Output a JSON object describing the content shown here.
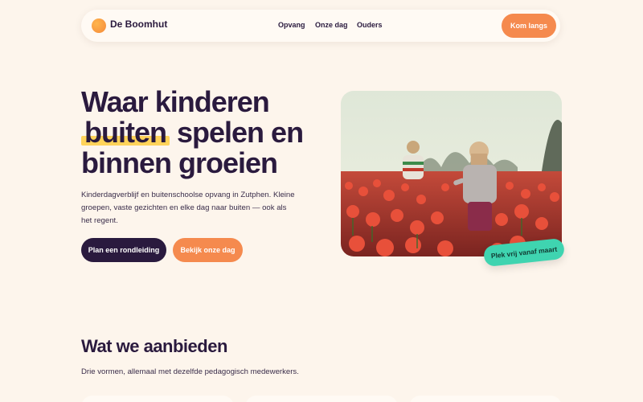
{
  "nav": {
    "brand": "De Boomhut",
    "links": [
      "Opvang",
      "Onze dag",
      "Ouders"
    ],
    "cta": "Kom langs"
  },
  "hero": {
    "title_part1": "Waar kinderen",
    "title_highlight": "buiten",
    "title_part2": "spelen en binnen groeien",
    "subtitle": "Kinderdagverblijf en buitenschoolse opvang in Zutphen. Kleine groepen, vaste gezichten en elke dag naar buiten — ook als het regent.",
    "primary_button": "Plan een rondleiding",
    "secondary_button": "Bekijk onze dag",
    "badge": "Plek vrij vanaf maart"
  },
  "offer": {
    "title": "Wat we aanbieden",
    "subtitle": "Drie vormen, allemaal met dezelfde pedagogisch medewerkers."
  },
  "colors": {
    "background": "#fdf5ec",
    "ink": "#2a1a3e",
    "accent_orange": "#f58a4e",
    "highlight_yellow": "#ffd35a",
    "badge_green": "#3fd4b0"
  }
}
